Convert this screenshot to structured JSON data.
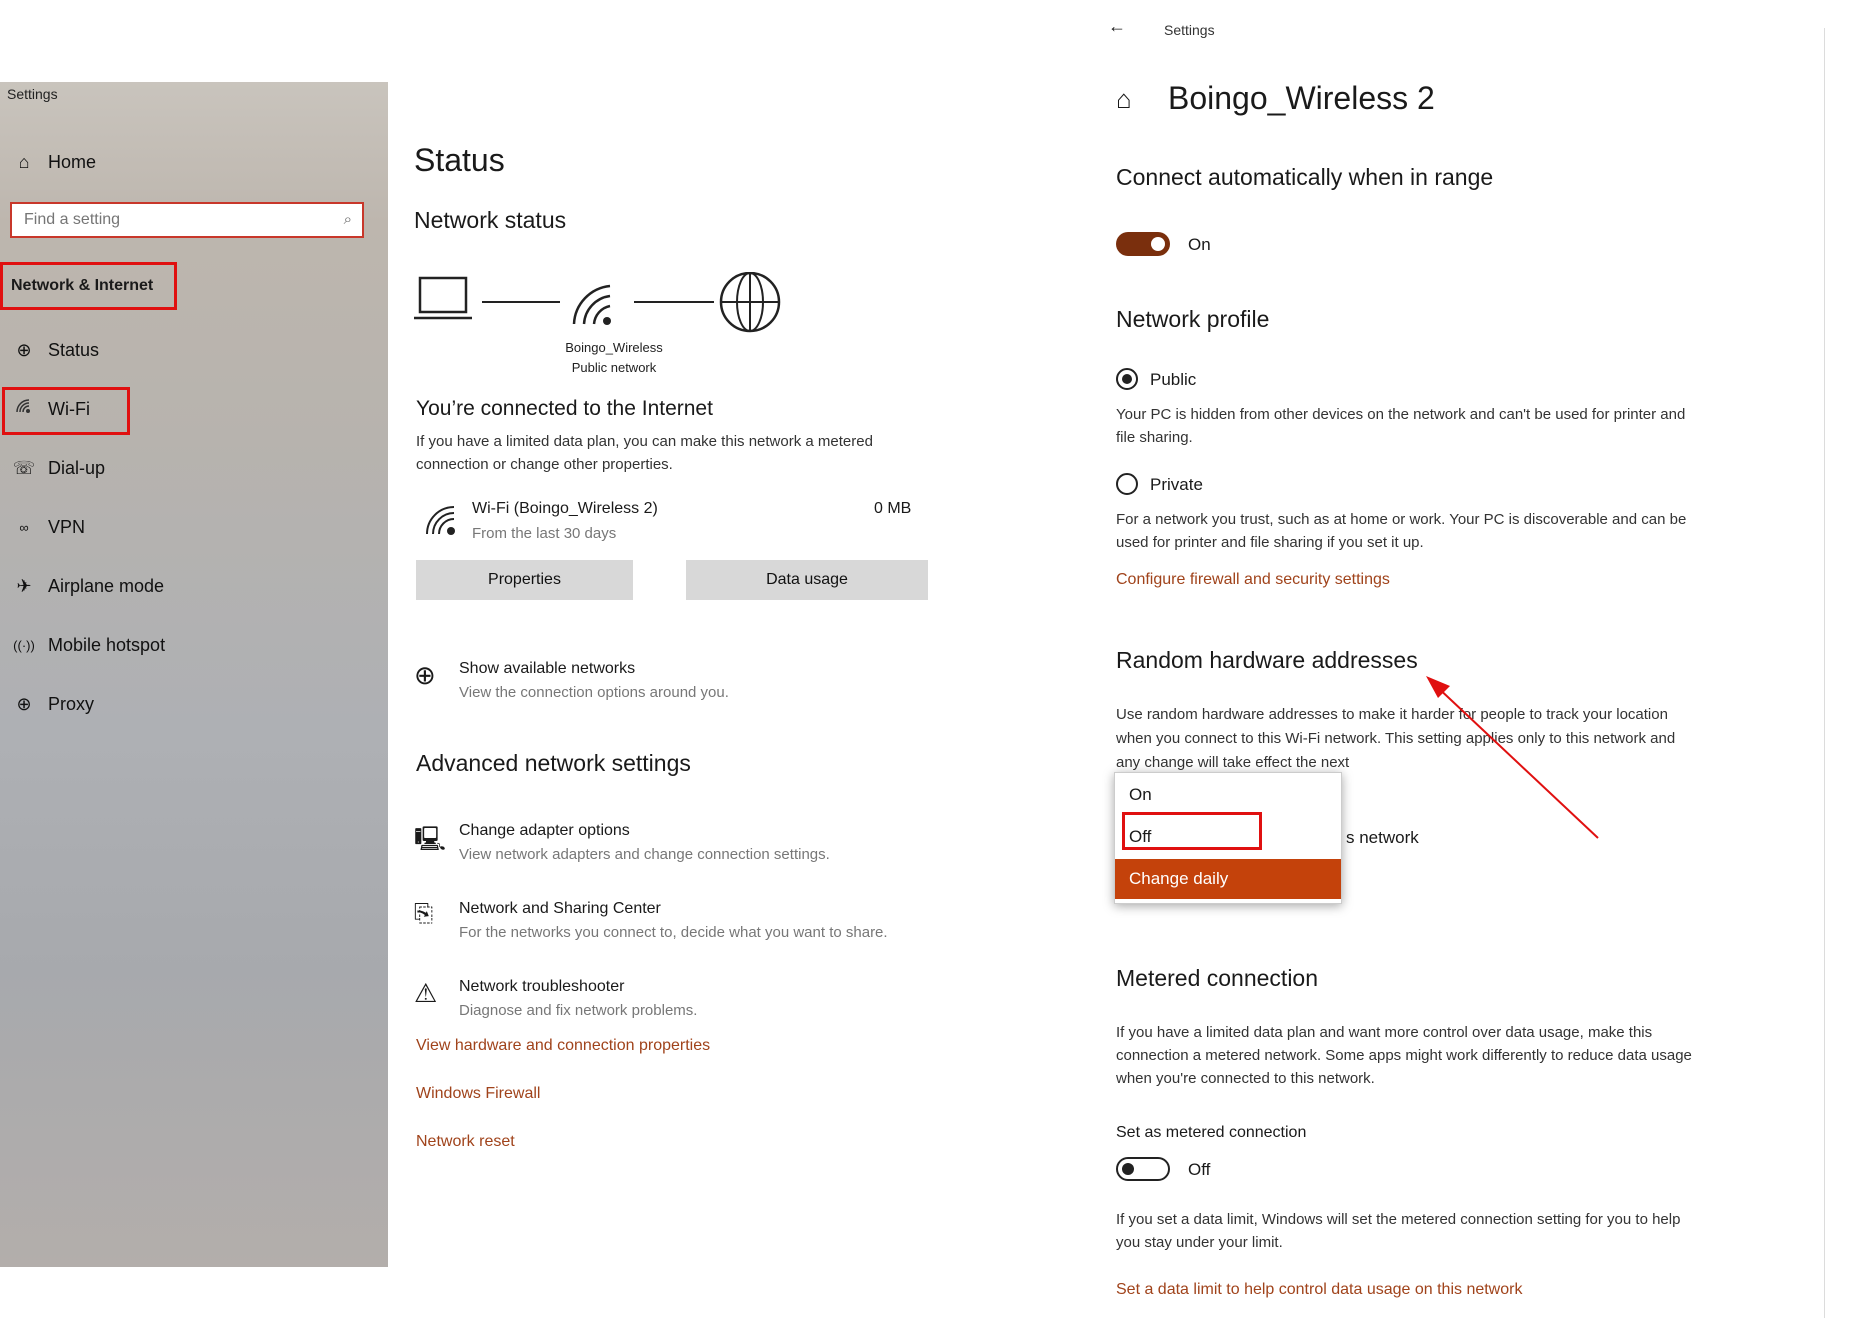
{
  "left": {
    "app_title": "Settings",
    "home_label": "Home",
    "search_placeholder": "Find a setting",
    "category": "Network & Internet",
    "nav_items": [
      {
        "label": "Status",
        "icon": "globe-icon"
      },
      {
        "label": "Wi-Fi",
        "icon": "wifi-icon"
      },
      {
        "label": "Dial-up",
        "icon": "phone-icon"
      },
      {
        "label": "VPN",
        "icon": "vpn-icon"
      },
      {
        "label": "Airplane mode",
        "icon": "airplane-icon"
      },
      {
        "label": "Mobile hotspot",
        "icon": "hotspot-icon"
      },
      {
        "label": "Proxy",
        "icon": "globe-icon"
      }
    ],
    "page_title": "Status",
    "network_status_heading": "Network status",
    "diagram_network_name": "Boingo_Wireless",
    "diagram_network_type": "Public network",
    "connected_heading": "You’re connected to the Internet",
    "connected_text": "If you have a limited data plan, you can make this network a metered connection or change other properties.",
    "connection_name": "Wi-Fi (Boingo_Wireless 2)",
    "connection_period": "From the last 30 days",
    "connection_usage": "0 MB",
    "properties_button": "Properties",
    "data_usage_button": "Data usage",
    "show_networks_title": "Show available networks",
    "show_networks_sub": "View the connection options around you.",
    "advanced_heading": "Advanced network settings",
    "advanced_items": [
      {
        "title": "Change adapter options",
        "sub": "View network adapters and change connection settings."
      },
      {
        "title": "Network and Sharing Center",
        "sub": "For the networks you connect to, decide what you want to share."
      },
      {
        "title": "Network troubleshooter",
        "sub": "Diagnose and fix network problems."
      }
    ],
    "links": [
      "View hardware and connection properties",
      "Windows Firewall",
      "Network reset"
    ]
  },
  "right": {
    "back_label": "←",
    "app_title": "Settings",
    "page_title": "Boingo_Wireless 2",
    "connect_auto_heading": "Connect automatically when in range",
    "connect_auto_state": "On",
    "network_profile_heading": "Network profile",
    "public_label": "Public",
    "public_desc": "Your PC is hidden from other devices on the network and can't be used for printer and file sharing.",
    "private_label": "Private",
    "private_desc": "For a network you trust, such as at home or work. Your PC is discoverable and can be used for printer and file sharing if you set it up.",
    "firewall_link": "Configure firewall and security settings",
    "random_hw_heading": "Random hardware addresses",
    "random_hw_desc": "Use random hardware addresses to make it harder for people to track your location when you connect to this Wi-Fi network. This setting applies only to this network and any change will take effect the next",
    "random_hw_trailing": "s network",
    "dropdown_options": [
      "On",
      "Off",
      "Change daily"
    ],
    "metered_heading": "Metered connection",
    "metered_desc": "If you have a limited data plan and want more control over data usage, make this connection a metered network. Some apps might work differently to reduce data usage when you're connected to this network.",
    "set_metered_label": "Set as metered connection",
    "metered_state": "Off",
    "data_limit_desc": "If you set a data limit, Windows will set the metered connection setting for you to help you stay under your limit.",
    "data_limit_link": "Set a data limit to help control data usage on this network"
  },
  "colors": {
    "accent": "#a0431b",
    "toggle_on": "#7a2f0d",
    "selected": "#c4420b",
    "highlight": "#e01010"
  }
}
